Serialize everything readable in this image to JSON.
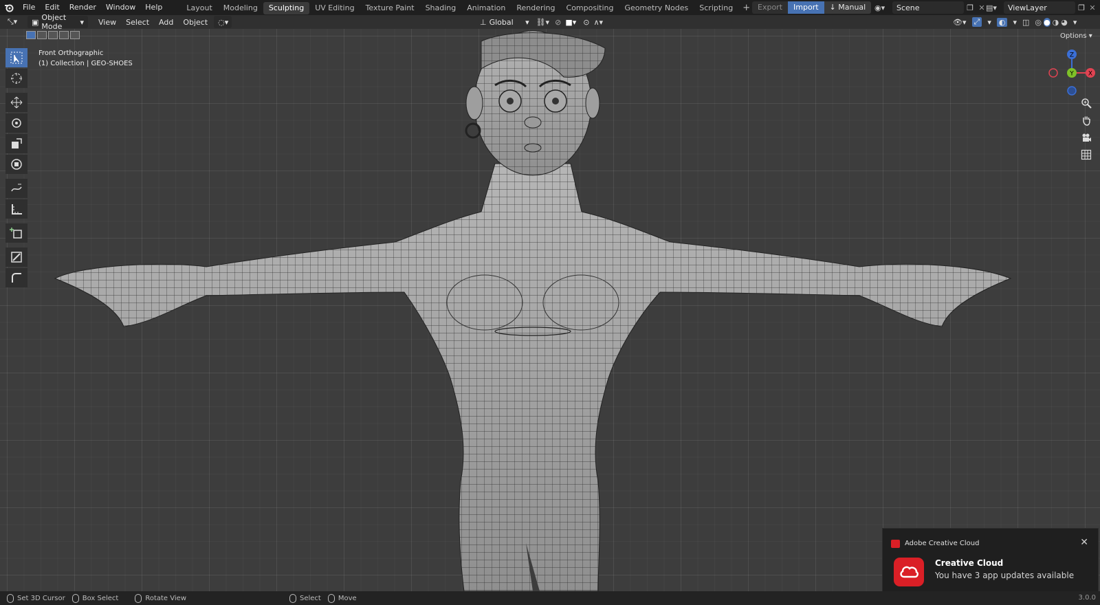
{
  "menu": {
    "items": [
      "File",
      "Edit",
      "Render",
      "Window",
      "Help"
    ]
  },
  "workspaces": {
    "tabs": [
      "Layout",
      "Modeling",
      "Sculpting",
      "UV Editing",
      "Texture Paint",
      "Shading",
      "Animation",
      "Rendering",
      "Compositing",
      "Geometry Nodes",
      "Scripting"
    ],
    "active": "Sculpting"
  },
  "topright": {
    "export_label": "Export",
    "import_label": "Import",
    "manual_label": "Manual",
    "scene_value": "Scene",
    "viewlayer_value": "ViewLayer"
  },
  "header": {
    "mode": "Object Mode",
    "menus": [
      "View",
      "Select",
      "Add",
      "Object"
    ],
    "transform_orientation": "Global",
    "options_label": "Options"
  },
  "viewport": {
    "view_name": "Front Orthographic",
    "collection": "(1) Collection | GEO-SHOES"
  },
  "gizmo": {
    "x_label": "X",
    "y_label": "Y",
    "z_label": "Z"
  },
  "statusbar": {
    "items": [
      "Set 3D Cursor",
      "Box Select",
      "Rotate View",
      "Select",
      "Move"
    ],
    "version": "3.0.0"
  },
  "notification": {
    "app": "Adobe Creative Cloud",
    "title": "Creative Cloud",
    "message": "You have 3 app updates available"
  },
  "colors": {
    "accent": "#4772b3",
    "background": "#3d3d3d",
    "header": "#1f1f1f",
    "adobe_red": "#da1f26"
  }
}
